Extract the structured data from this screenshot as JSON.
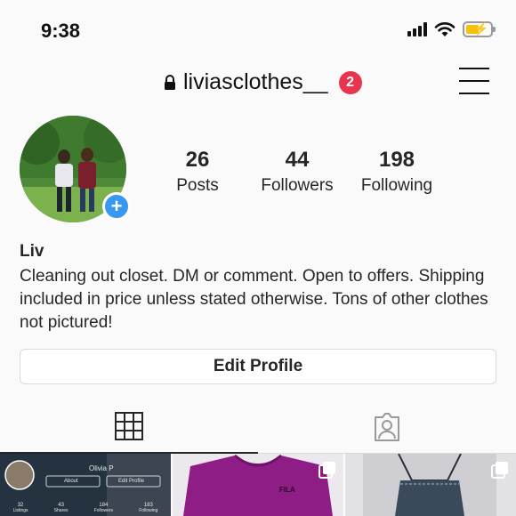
{
  "status": {
    "time": "9:38"
  },
  "header": {
    "username": "liviasclothes__",
    "notification_count": "2"
  },
  "profile": {
    "stats": [
      {
        "value": "26",
        "label": "Posts"
      },
      {
        "value": "44",
        "label": "Followers"
      },
      {
        "value": "198",
        "label": "Following"
      }
    ],
    "name": "Liv",
    "bio": "Cleaning out closet. DM or comment. Open to offers. Shipping included in price unless stated otherwise. Tons of other clothes not pictured!",
    "edit_button": "Edit Profile"
  },
  "grid": {
    "post1": {
      "name": "Olivia P",
      "about": "About",
      "edit": "Edit Profile",
      "stats": [
        {
          "value": "32",
          "label": "Listings"
        },
        {
          "value": "43",
          "label": "Shares"
        },
        {
          "value": "184",
          "label": "Followers"
        },
        {
          "value": "183",
          "label": "Following"
        }
      ]
    },
    "post2": {
      "brand": "FILA"
    }
  },
  "colors": {
    "accent": "#3897f0",
    "badge": "#e8344e",
    "text": "#262626"
  }
}
